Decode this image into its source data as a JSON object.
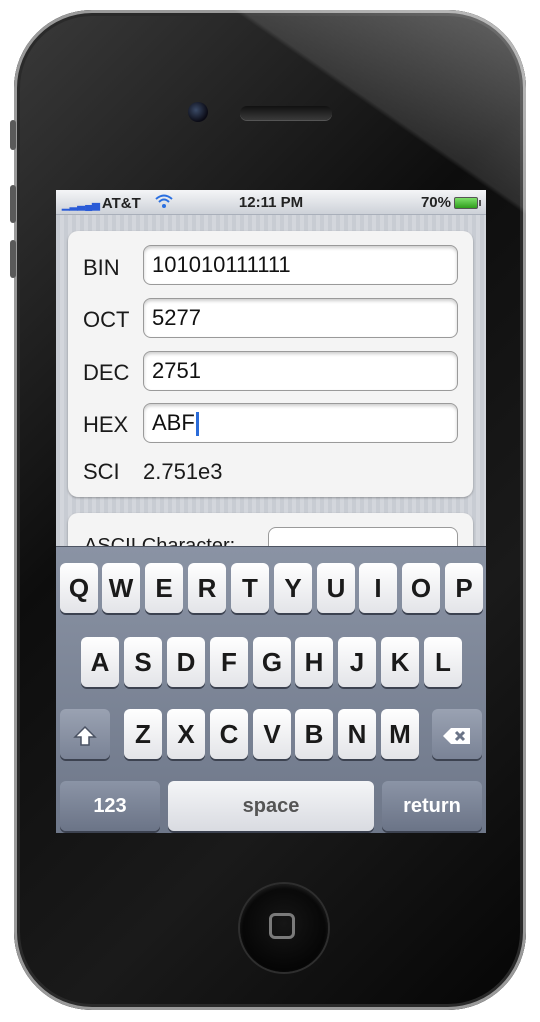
{
  "status_bar": {
    "carrier": "AT&T",
    "time": "12:11 PM",
    "battery": "70%"
  },
  "converter": {
    "bin_label": "BIN",
    "bin_value": "101010111111",
    "oct_label": "OCT",
    "oct_value": "5277",
    "dec_label": "DEC",
    "dec_value": "2751",
    "hex_label": "HEX",
    "hex_value": "ABF",
    "sci_label": "SCI",
    "sci_value": "2.751e3"
  },
  "ascii": {
    "label": "ASCII Character:"
  },
  "keyboard": {
    "row1": [
      "Q",
      "W",
      "E",
      "R",
      "T",
      "Y",
      "U",
      "I",
      "O",
      "P"
    ],
    "row2": [
      "A",
      "S",
      "D",
      "F",
      "G",
      "H",
      "J",
      "K",
      "L"
    ],
    "row3": [
      "Z",
      "X",
      "C",
      "V",
      "B",
      "N",
      "M"
    ],
    "numbers_key": "123",
    "space_key": "space",
    "return_key": "return",
    "shift_icon": "shift-icon",
    "delete_icon": "backspace-icon"
  }
}
